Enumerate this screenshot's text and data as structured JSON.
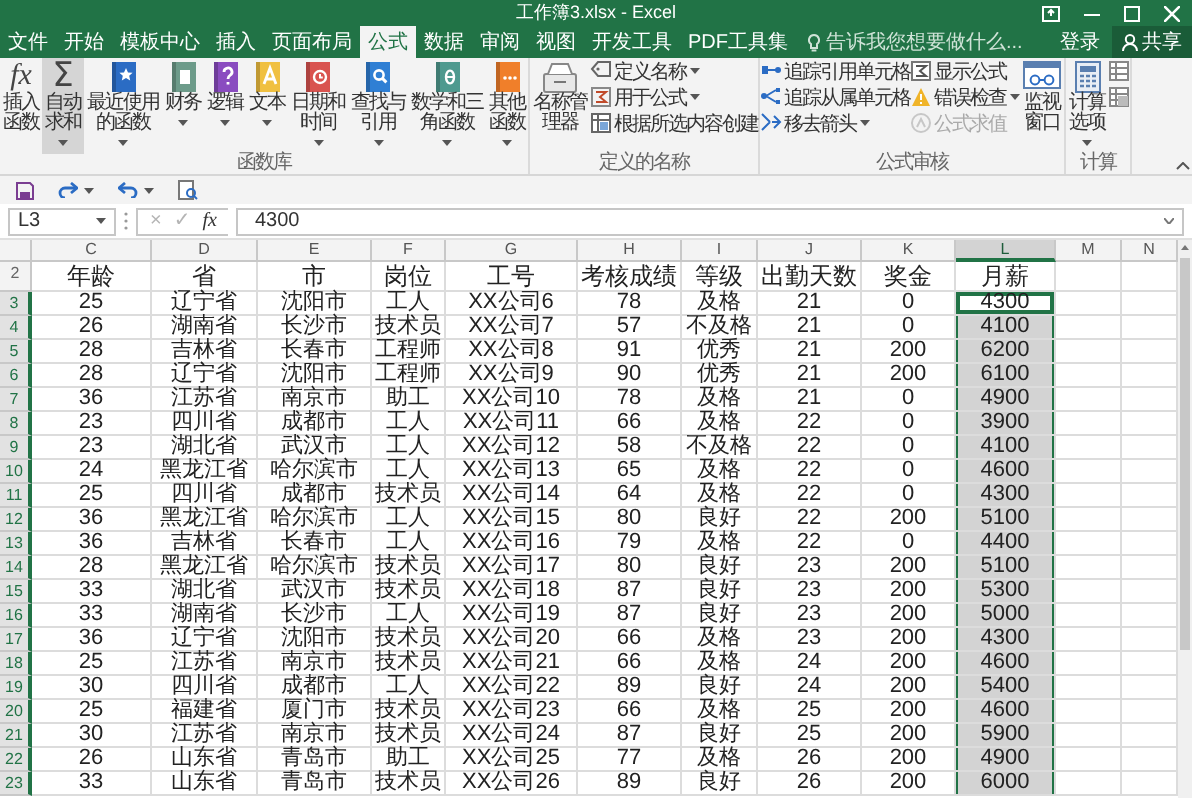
{
  "title_bar": {
    "title": "工作簿3.xlsx - Excel"
  },
  "tabs": [
    {
      "label": "文件",
      "selected": false
    },
    {
      "label": "开始",
      "selected": false
    },
    {
      "label": "模板中心",
      "selected": false
    },
    {
      "label": "插入",
      "selected": false
    },
    {
      "label": "页面布局",
      "selected": false
    },
    {
      "label": "公式",
      "selected": true
    },
    {
      "label": "数据",
      "selected": false
    },
    {
      "label": "审阅",
      "selected": false
    },
    {
      "label": "视图",
      "selected": false
    },
    {
      "label": "开发工具",
      "selected": false
    },
    {
      "label": "PDF工具集",
      "selected": false
    }
  ],
  "tell_me": {
    "placeholder": "告诉我您想要做什么..."
  },
  "account": {
    "sign_in": "登录",
    "share": "共享"
  },
  "ribbon": {
    "groups": [
      {
        "label": "函数库",
        "items": [
          {
            "kind": "large",
            "label": "插入函数",
            "symbol": "fx",
            "dropdown": false,
            "disabled": false,
            "highlighted": false
          },
          {
            "kind": "large",
            "label": "自动求和",
            "symbol": "Σ",
            "dropdown": true,
            "disabled": false,
            "highlighted": true
          },
          {
            "kind": "large",
            "label": "最近使用的函数",
            "dropdown": true,
            "disabled": false,
            "highlighted": false
          },
          {
            "kind": "large",
            "label": "财务",
            "dropdown": true,
            "disabled": false,
            "highlighted": false
          },
          {
            "kind": "large",
            "label": "逻辑",
            "dropdown": true,
            "disabled": false,
            "highlighted": false
          },
          {
            "kind": "large",
            "label": "文本",
            "dropdown": true,
            "disabled": false,
            "highlighted": false
          },
          {
            "kind": "large",
            "label": "日期和时间",
            "dropdown": true,
            "disabled": false,
            "highlighted": false
          },
          {
            "kind": "large",
            "label": "查找与引用",
            "dropdown": true,
            "disabled": false,
            "highlighted": false
          },
          {
            "kind": "large",
            "label": "数学和三角函数",
            "dropdown": true,
            "disabled": false,
            "highlighted": false
          },
          {
            "kind": "large",
            "label": "其他函数",
            "dropdown": true,
            "disabled": false,
            "highlighted": false
          }
        ]
      },
      {
        "label": "定义的名称",
        "items": [
          {
            "kind": "large",
            "label": "名称管理器",
            "dropdown": false,
            "disabled": false,
            "highlighted": false
          },
          {
            "kind": "small",
            "label": "定义名称",
            "dropdown": true,
            "disabled": false
          },
          {
            "kind": "small",
            "label": "用于公式",
            "dropdown": true,
            "disabled": false
          },
          {
            "kind": "small",
            "label": "根据所选内容创建",
            "dropdown": false,
            "disabled": false
          }
        ]
      },
      {
        "label": "公式审核",
        "items": [
          {
            "kind": "small",
            "label": "追踪引用单元格",
            "dropdown": false,
            "disabled": false
          },
          {
            "kind": "small",
            "label": "追踪从属单元格",
            "dropdown": false,
            "disabled": false
          },
          {
            "kind": "small",
            "label": "移去箭头",
            "dropdown": true,
            "disabled": false
          },
          {
            "kind": "small",
            "label": "显示公式",
            "dropdown": false,
            "disabled": false
          },
          {
            "kind": "small",
            "label": "错误检查",
            "dropdown": true,
            "disabled": false
          },
          {
            "kind": "small",
            "label": "公式求值",
            "dropdown": false,
            "disabled": true
          },
          {
            "kind": "large",
            "label": "监视窗口",
            "dropdown": false,
            "disabled": false,
            "highlighted": false
          }
        ]
      },
      {
        "label": "计算",
        "items": [
          {
            "kind": "large",
            "label": "计算选项",
            "dropdown": true,
            "disabled": false,
            "highlighted": false
          },
          {
            "kind": "icon",
            "disabled": false
          },
          {
            "kind": "icon",
            "disabled": false
          }
        ]
      }
    ]
  },
  "formula_bar": {
    "name_box": "L3",
    "cancel": "×",
    "enter": "✓",
    "function": "fx",
    "value": "4300"
  },
  "sheet": {
    "columns": [
      {
        "label": "C",
        "selected": false
      },
      {
        "label": "D",
        "selected": false
      },
      {
        "label": "E",
        "selected": false
      },
      {
        "label": "F",
        "selected": false
      },
      {
        "label": "G",
        "selected": false
      },
      {
        "label": "H",
        "selected": false
      },
      {
        "label": "I",
        "selected": false
      },
      {
        "label": "J",
        "selected": false
      },
      {
        "label": "K",
        "selected": false
      },
      {
        "label": "L",
        "selected": true
      },
      {
        "label": "M",
        "selected": false
      },
      {
        "label": "N",
        "selected": false
      }
    ],
    "rows": [
      {
        "number": "2",
        "kind": "header",
        "selected": false,
        "active": false,
        "cells": [
          "年龄",
          "省",
          "市",
          "岗位",
          "工号",
          "考核成绩",
          "等级",
          "出勤天数",
          "奖金",
          "月薪"
        ]
      },
      {
        "number": "3",
        "kind": "data",
        "selected": true,
        "active": true,
        "cells": [
          "25",
          "辽宁省",
          "沈阳市",
          "工人",
          "XX公司6",
          "78",
          "及格",
          "21",
          "0",
          "4300"
        ]
      },
      {
        "number": "4",
        "kind": "data",
        "selected": true,
        "active": false,
        "cells": [
          "26",
          "湖南省",
          "长沙市",
          "技术员",
          "XX公司7",
          "57",
          "不及格",
          "21",
          "0",
          "4100"
        ]
      },
      {
        "number": "5",
        "kind": "data",
        "selected": true,
        "active": false,
        "cells": [
          "28",
          "吉林省",
          "长春市",
          "工程师",
          "XX公司8",
          "91",
          "优秀",
          "21",
          "200",
          "6200"
        ]
      },
      {
        "number": "6",
        "kind": "data",
        "selected": true,
        "active": false,
        "cells": [
          "28",
          "辽宁省",
          "沈阳市",
          "工程师",
          "XX公司9",
          "90",
          "优秀",
          "21",
          "200",
          "6100"
        ]
      },
      {
        "number": "7",
        "kind": "data",
        "selected": true,
        "active": false,
        "cells": [
          "36",
          "江苏省",
          "南京市",
          "助工",
          "XX公司10",
          "78",
          "及格",
          "21",
          "0",
          "4900"
        ]
      },
      {
        "number": "8",
        "kind": "data",
        "selected": true,
        "active": false,
        "cells": [
          "23",
          "四川省",
          "成都市",
          "工人",
          "XX公司11",
          "66",
          "及格",
          "22",
          "0",
          "3900"
        ]
      },
      {
        "number": "9",
        "kind": "data",
        "selected": true,
        "active": false,
        "cells": [
          "23",
          "湖北省",
          "武汉市",
          "工人",
          "XX公司12",
          "58",
          "不及格",
          "22",
          "0",
          "4100"
        ]
      },
      {
        "number": "10",
        "kind": "data",
        "selected": true,
        "active": false,
        "cells": [
          "24",
          "黑龙江省",
          "哈尔滨市",
          "工人",
          "XX公司13",
          "65",
          "及格",
          "22",
          "0",
          "4600"
        ]
      },
      {
        "number": "11",
        "kind": "data",
        "selected": true,
        "active": false,
        "cells": [
          "25",
          "四川省",
          "成都市",
          "技术员",
          "XX公司14",
          "64",
          "及格",
          "22",
          "0",
          "4300"
        ]
      },
      {
        "number": "12",
        "kind": "data",
        "selected": true,
        "active": false,
        "cells": [
          "36",
          "黑龙江省",
          "哈尔滨市",
          "工人",
          "XX公司15",
          "80",
          "良好",
          "22",
          "200",
          "5100"
        ]
      },
      {
        "number": "13",
        "kind": "data",
        "selected": true,
        "active": false,
        "cells": [
          "36",
          "吉林省",
          "长春市",
          "工人",
          "XX公司16",
          "79",
          "及格",
          "22",
          "0",
          "4400"
        ]
      },
      {
        "number": "14",
        "kind": "data",
        "selected": true,
        "active": false,
        "cells": [
          "28",
          "黑龙江省",
          "哈尔滨市",
          "技术员",
          "XX公司17",
          "80",
          "良好",
          "23",
          "200",
          "5100"
        ]
      },
      {
        "number": "15",
        "kind": "data",
        "selected": true,
        "active": false,
        "cells": [
          "33",
          "湖北省",
          "武汉市",
          "技术员",
          "XX公司18",
          "87",
          "良好",
          "23",
          "200",
          "5300"
        ]
      },
      {
        "number": "16",
        "kind": "data",
        "selected": true,
        "active": false,
        "cells": [
          "33",
          "湖南省",
          "长沙市",
          "工人",
          "XX公司19",
          "87",
          "良好",
          "23",
          "200",
          "5000"
        ]
      },
      {
        "number": "17",
        "kind": "data",
        "selected": true,
        "active": false,
        "cells": [
          "36",
          "辽宁省",
          "沈阳市",
          "技术员",
          "XX公司20",
          "66",
          "及格",
          "23",
          "200",
          "4300"
        ]
      },
      {
        "number": "18",
        "kind": "data",
        "selected": true,
        "active": false,
        "cells": [
          "25",
          "江苏省",
          "南京市",
          "技术员",
          "XX公司21",
          "66",
          "及格",
          "24",
          "200",
          "4600"
        ]
      },
      {
        "number": "19",
        "kind": "data",
        "selected": true,
        "active": false,
        "cells": [
          "30",
          "四川省",
          "成都市",
          "工人",
          "XX公司22",
          "89",
          "良好",
          "24",
          "200",
          "5400"
        ]
      },
      {
        "number": "20",
        "kind": "data",
        "selected": true,
        "active": false,
        "cells": [
          "25",
          "福建省",
          "厦门市",
          "技术员",
          "XX公司23",
          "66",
          "及格",
          "25",
          "200",
          "4600"
        ]
      },
      {
        "number": "21",
        "kind": "data",
        "selected": true,
        "active": false,
        "cells": [
          "30",
          "江苏省",
          "南京市",
          "技术员",
          "XX公司24",
          "87",
          "良好",
          "25",
          "200",
          "5900"
        ]
      },
      {
        "number": "22",
        "kind": "data",
        "selected": true,
        "active": false,
        "cells": [
          "26",
          "山东省",
          "青岛市",
          "助工",
          "XX公司25",
          "77",
          "及格",
          "26",
          "200",
          "4900"
        ]
      },
      {
        "number": "23",
        "kind": "data",
        "selected": true,
        "active": false,
        "cells": [
          "33",
          "山东省",
          "青岛市",
          "技术员",
          "XX公司26",
          "89",
          "良好",
          "26",
          "200",
          "6000"
        ]
      }
    ]
  }
}
